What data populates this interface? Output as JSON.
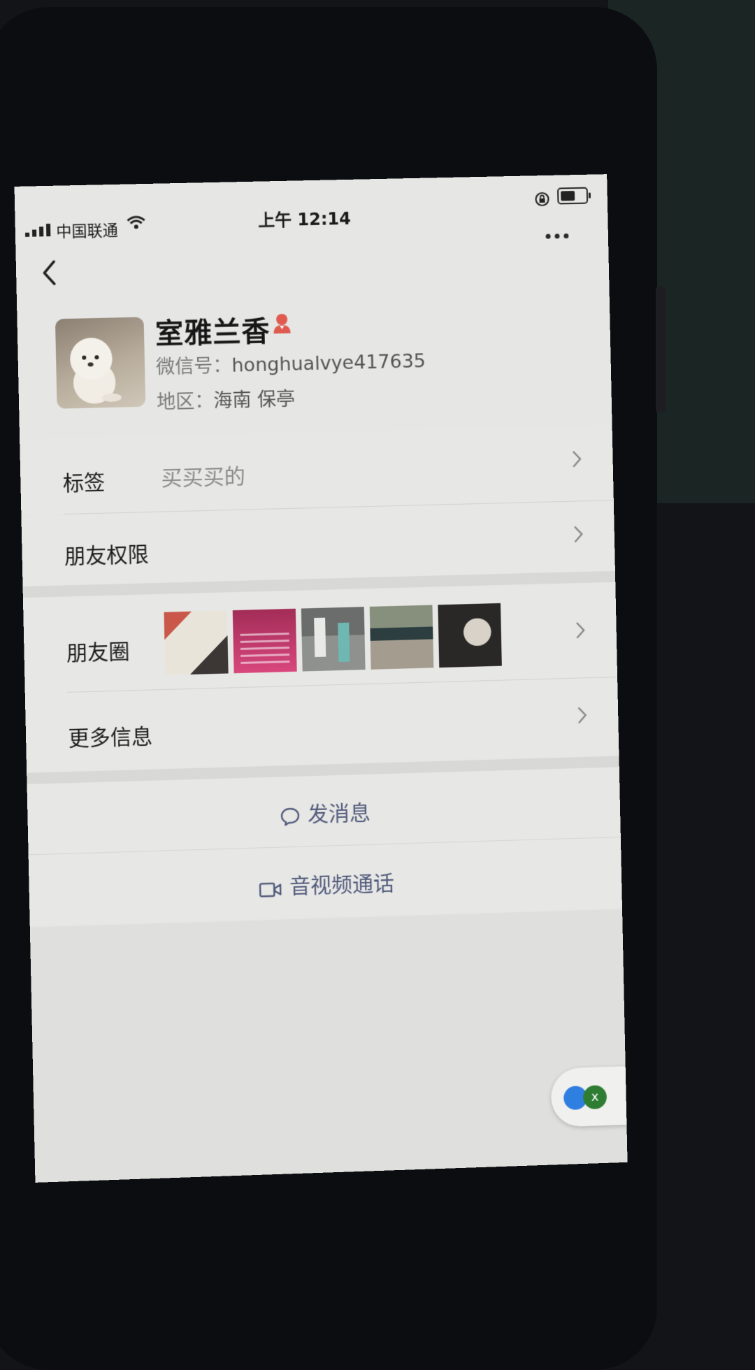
{
  "status_bar": {
    "carrier": "中国联通",
    "time": "上午 12:14"
  },
  "profile": {
    "name": "室雅兰香",
    "wechat_id_label": "微信号：",
    "wechat_id": "honghualvye417635",
    "region_label": "地区：",
    "region": "海南 保亭"
  },
  "rows": {
    "tag_label": "标签",
    "tag_value": "买买买的",
    "permission_label": "朋友权限",
    "moments_label": "朋友圈",
    "more_info_label": "更多信息"
  },
  "actions": {
    "message": "发消息",
    "call": "音视频通话"
  },
  "floating": {
    "close_label": "x"
  },
  "icons": {
    "back": "chevron-left-icon",
    "more": "more-icon",
    "gender": "female-icon",
    "message": "chat-bubble-icon",
    "call": "video-camera-icon"
  },
  "colors": {
    "action_text": "#525b7c",
    "female_icon": "#e05a4f"
  }
}
